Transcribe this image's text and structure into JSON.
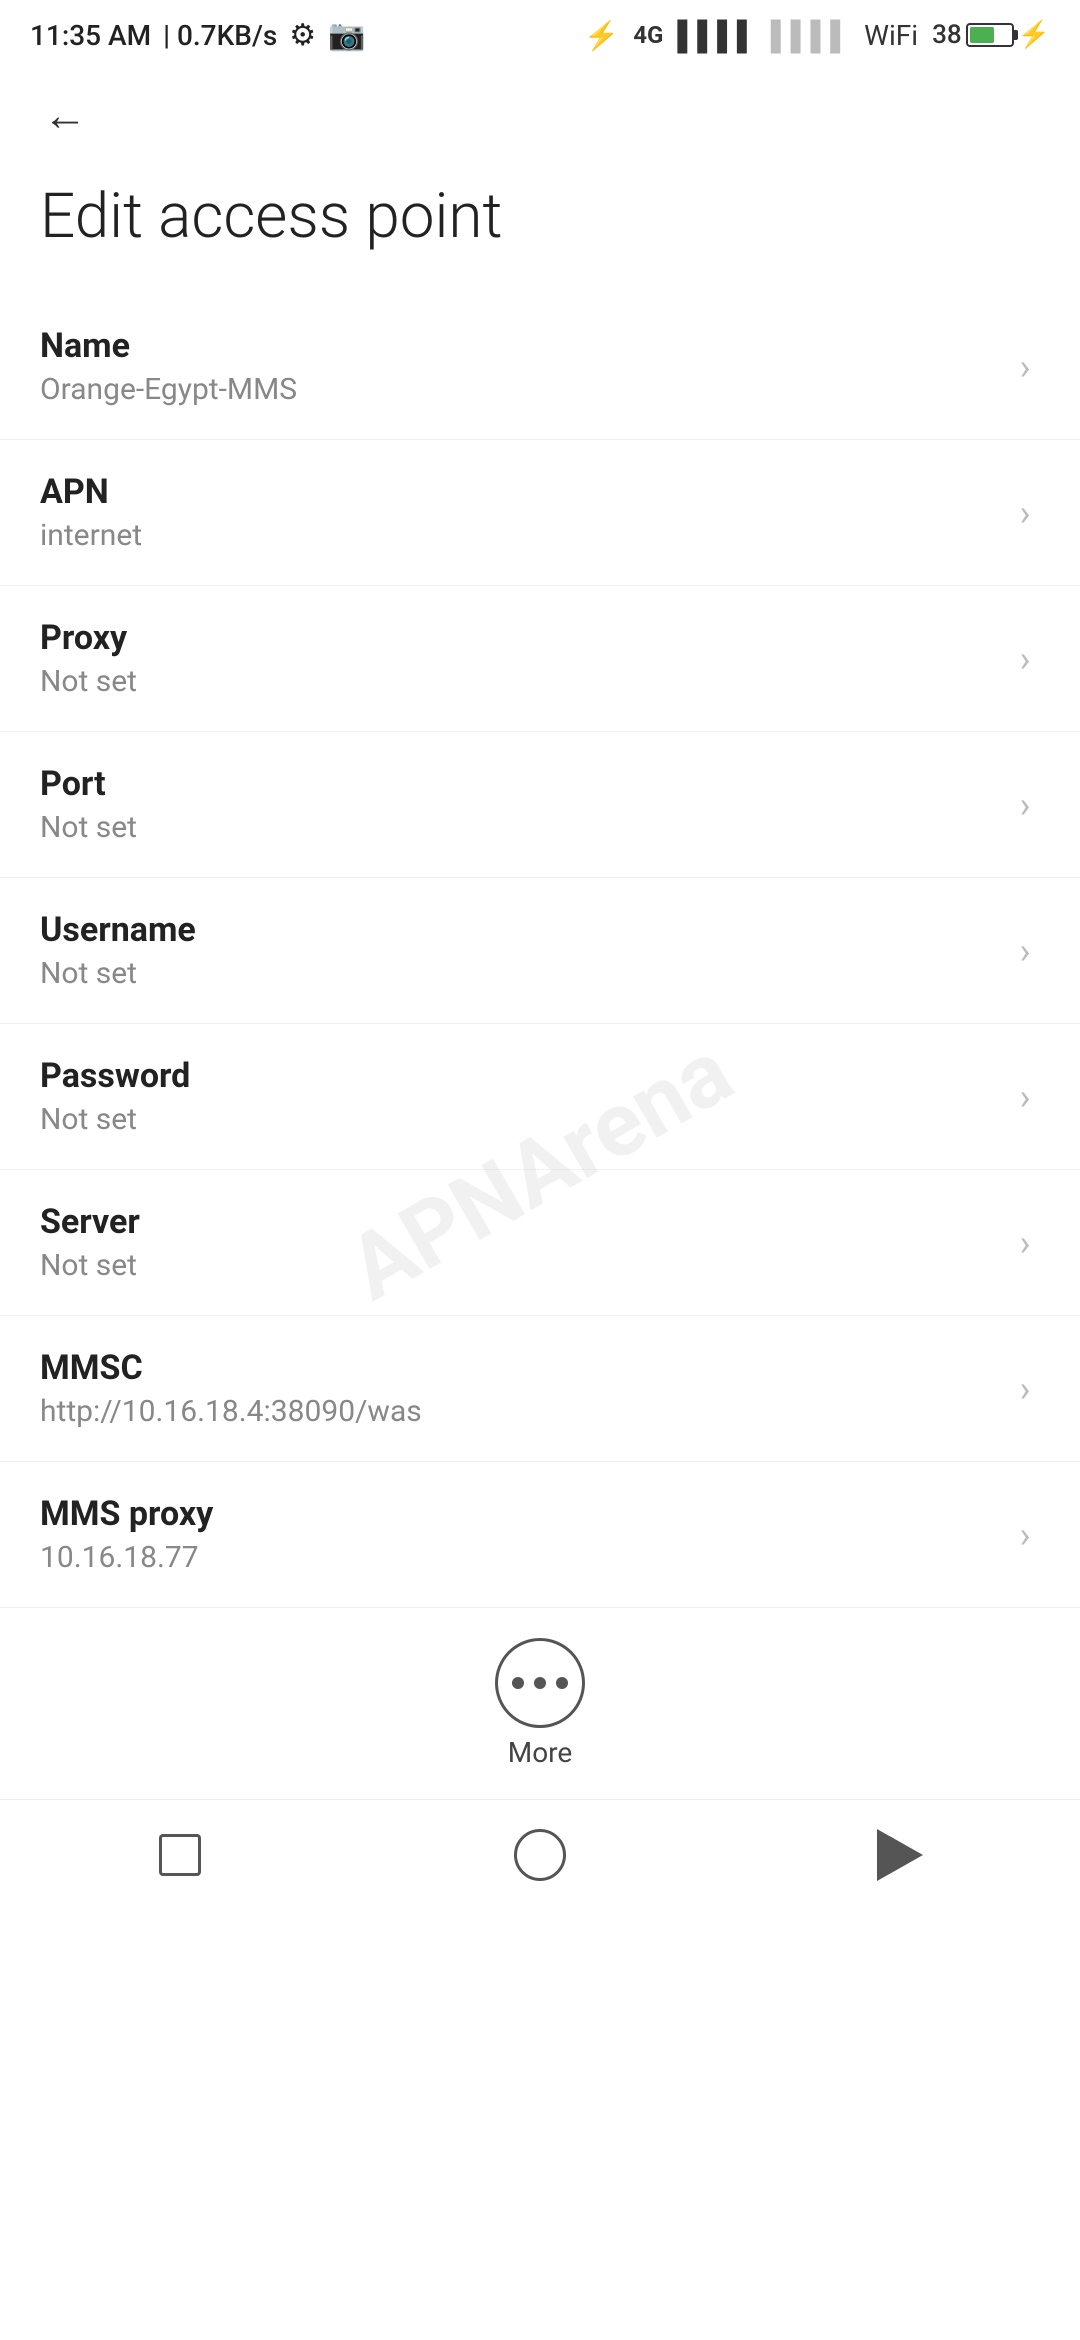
{
  "statusBar": {
    "time": "11:35 AM",
    "speed": "0.7KB/s"
  },
  "nav": {
    "backLabel": "←"
  },
  "page": {
    "title": "Edit access point"
  },
  "settings": [
    {
      "label": "Name",
      "value": "Orange-Egypt-MMS"
    },
    {
      "label": "APN",
      "value": "internet"
    },
    {
      "label": "Proxy",
      "value": "Not set"
    },
    {
      "label": "Port",
      "value": "Not set"
    },
    {
      "label": "Username",
      "value": "Not set"
    },
    {
      "label": "Password",
      "value": "Not set"
    },
    {
      "label": "Server",
      "value": "Not set"
    },
    {
      "label": "MMSC",
      "value": "http://10.16.18.4:38090/was"
    },
    {
      "label": "MMS proxy",
      "value": "10.16.18.77"
    }
  ],
  "more": {
    "label": "More"
  },
  "watermark": "APNArena"
}
